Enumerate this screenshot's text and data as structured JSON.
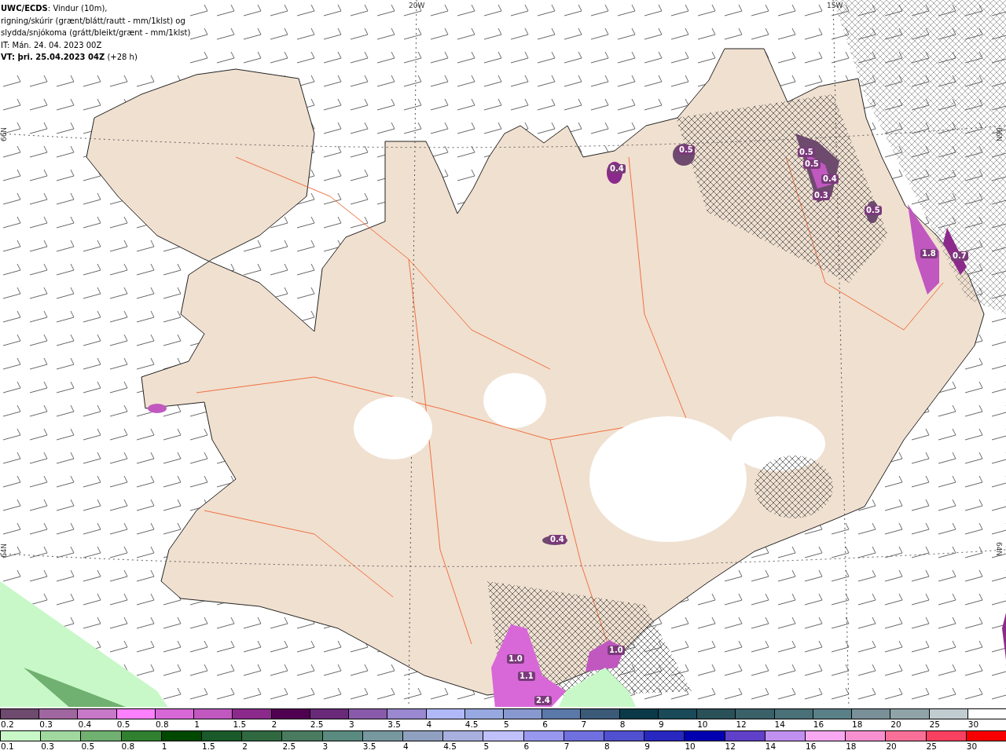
{
  "title_box": {
    "lines": [
      "**UWC/ECDS**: Vindur (10m),",
      "rigning/skúrir (grænt/blátt/rautt - mm/1klst) og",
      "slydda/snjókoma (grátt/bleikt/grænt - mm/1klst)",
      "IT: Mán. 24. 04. 2023 00Z",
      "**VT: þri. 25.04.2023 04Z** (+28 h)"
    ]
  },
  "map": {
    "grid_labels": [
      {
        "text": "20W"
      },
      {
        "text": "15W"
      },
      {
        "text": "66N"
      },
      {
        "text": "66N"
      },
      {
        "text": "64N"
      },
      {
        "text": "64N"
      }
    ],
    "value_labels": [
      {
        "text": "0.5"
      },
      {
        "text": "0.4"
      },
      {
        "text": "0.5"
      },
      {
        "text": "0.5"
      },
      {
        "text": "0.4"
      },
      {
        "text": "0.3"
      },
      {
        "text": "0.5"
      },
      {
        "text": "1.8"
      },
      {
        "text": "0.7"
      },
      {
        "text": "0.4"
      },
      {
        "text": "1.0"
      },
      {
        "text": "1.1"
      },
      {
        "text": "1.0"
      },
      {
        "text": "2.4"
      }
    ]
  },
  "legend": {
    "snow_scale": [
      {
        "label": "0.2",
        "color": "#6e4a6e"
      },
      {
        "label": "0.3",
        "color": "#a066a0"
      },
      {
        "label": "0.4",
        "color": "#c878c8"
      },
      {
        "label": "0.5",
        "color": "#ff80ff"
      },
      {
        "label": "0.8",
        "color": "#d868d8"
      },
      {
        "label": "1",
        "color": "#c058c0"
      },
      {
        "label": "1.5",
        "color": "#8c2a8c"
      },
      {
        "label": "2",
        "color": "#500050"
      },
      {
        "label": "2.5",
        "color": "#6a2a7a"
      },
      {
        "label": "3",
        "color": "#8a5aaa"
      },
      {
        "label": "3.5",
        "color": "#9a88d0"
      },
      {
        "label": "4",
        "color": "#b0b8f8"
      },
      {
        "label": "4.5",
        "color": "#98a8e0"
      },
      {
        "label": "5",
        "color": "#8898d0"
      },
      {
        "label": "6",
        "color": "#5a78a8"
      },
      {
        "label": "7",
        "color": "#3a5a78"
      },
      {
        "label": "8",
        "color": "#0a3a48"
      },
      {
        "label": "9",
        "color": "#1a4a58"
      },
      {
        "label": "10",
        "color": "#2a5058"
      },
      {
        "label": "12",
        "color": "#3a6068"
      },
      {
        "label": "14",
        "color": "#4a7078"
      },
      {
        "label": "16",
        "color": "#5a8088"
      },
      {
        "label": "18",
        "color": "#7a9098"
      },
      {
        "label": "20",
        "color": "#90a4a8"
      },
      {
        "label": "25",
        "color": "#c0ccd0"
      },
      {
        "label": "30",
        "color": "#ffffff"
      }
    ],
    "rain_scale": [
      {
        "label": "0.1",
        "color": "#c8f8c8"
      },
      {
        "label": "0.3",
        "color": "#a0d8a0"
      },
      {
        "label": "0.5",
        "color": "#70b070"
      },
      {
        "label": "0.8",
        "color": "#308030"
      },
      {
        "label": "1",
        "color": "#004800"
      },
      {
        "label": "1.5",
        "color": "#1a5a2a"
      },
      {
        "label": "2",
        "color": "#306840"
      },
      {
        "label": "2.5",
        "color": "#4a7a60"
      },
      {
        "label": "3",
        "color": "#5a8a80"
      },
      {
        "label": "3.5",
        "color": "#7898a0"
      },
      {
        "label": "4",
        "color": "#90a0c0"
      },
      {
        "label": "4.5",
        "color": "#a8b0e0"
      },
      {
        "label": "5",
        "color": "#c0c0ff"
      },
      {
        "label": "6",
        "color": "#9898f0"
      },
      {
        "label": "7",
        "color": "#7070e0"
      },
      {
        "label": "8",
        "color": "#5050d0"
      },
      {
        "label": "9",
        "color": "#2828c0"
      },
      {
        "label": "10",
        "color": "#0000b0"
      },
      {
        "label": "12",
        "color": "#6040c8"
      },
      {
        "label": "14",
        "color": "#c090f0"
      },
      {
        "label": "16",
        "color": "#f8a8f0"
      },
      {
        "label": "18",
        "color": "#f890d0"
      },
      {
        "label": "20",
        "color": "#f87098"
      },
      {
        "label": "25",
        "color": "#f84060"
      },
      {
        "label": "30",
        "color": "#f80000"
      }
    ]
  }
}
